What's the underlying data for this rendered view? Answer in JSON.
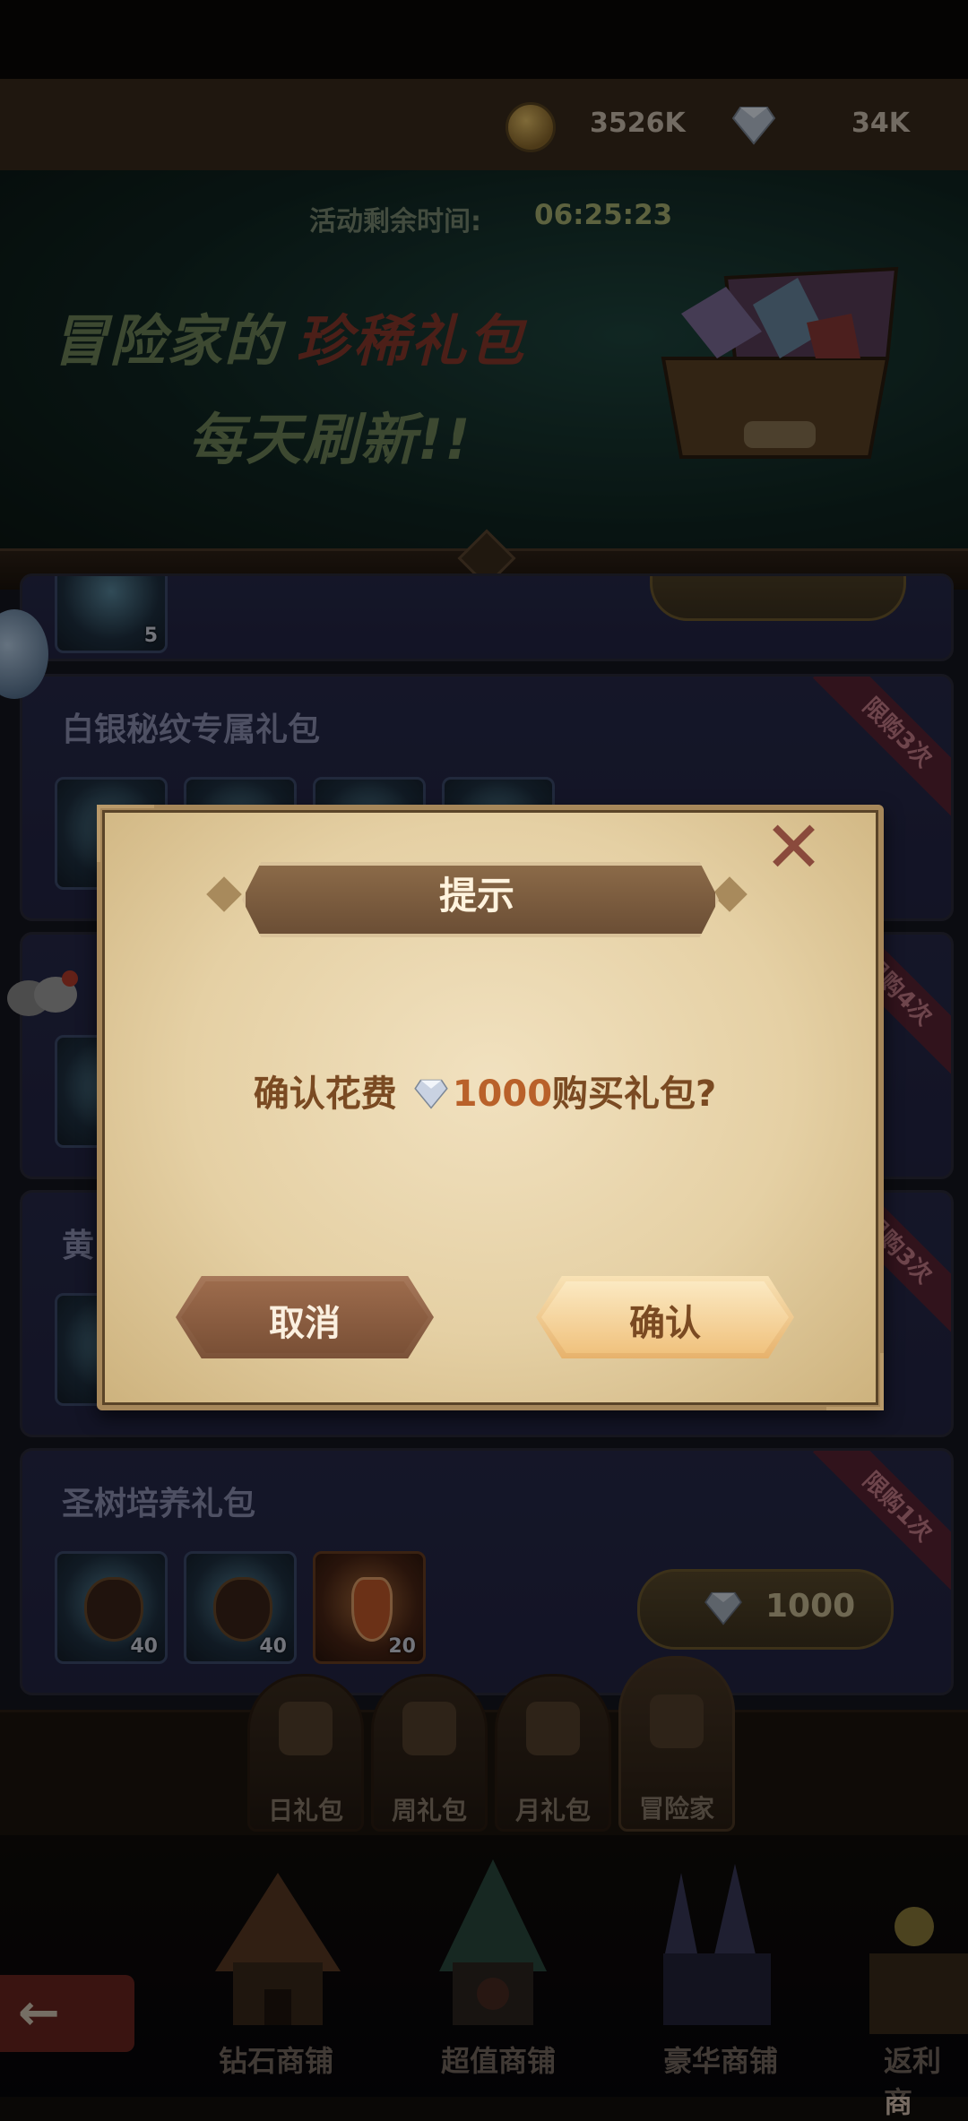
{
  "resources": {
    "coins": "3526K",
    "diamonds": "34K"
  },
  "banner": {
    "timer_label": "活动剩余时间:",
    "timer_value": "06:25:23",
    "line1_prefix": "冒险家的",
    "line1_highlight": "珍稀礼包",
    "line2": "每天刷新!!"
  },
  "packs": [
    {
      "partial_count": "5"
    },
    {
      "title": "白银秘纹专属礼包",
      "limit": "限购3次"
    },
    {
      "limit": "限购4次"
    },
    {
      "title_partial": "黄",
      "limit": "限购3次"
    },
    {
      "title": "圣树培养礼包",
      "limit": "限购1次",
      "items": [
        {
          "count": "40"
        },
        {
          "count": "40"
        },
        {
          "count": "20"
        }
      ],
      "price": "1000"
    }
  ],
  "tabs": [
    {
      "label": "日礼包"
    },
    {
      "label": "周礼包"
    },
    {
      "label": "月礼包"
    },
    {
      "label": "冒险家"
    }
  ],
  "nav": [
    {
      "label": "钻石商铺"
    },
    {
      "label": "超值商铺"
    },
    {
      "label": "豪华商铺"
    },
    {
      "label": "返利商"
    }
  ],
  "dialog": {
    "title": "提示",
    "message_prefix": "确认花费",
    "cost": "1000",
    "message_suffix": "购买礼包?",
    "cancel_label": "取消",
    "confirm_label": "确认"
  },
  "colors": {
    "accent_price": "#b9612a",
    "dialog_bg": "#e5d0a4"
  }
}
